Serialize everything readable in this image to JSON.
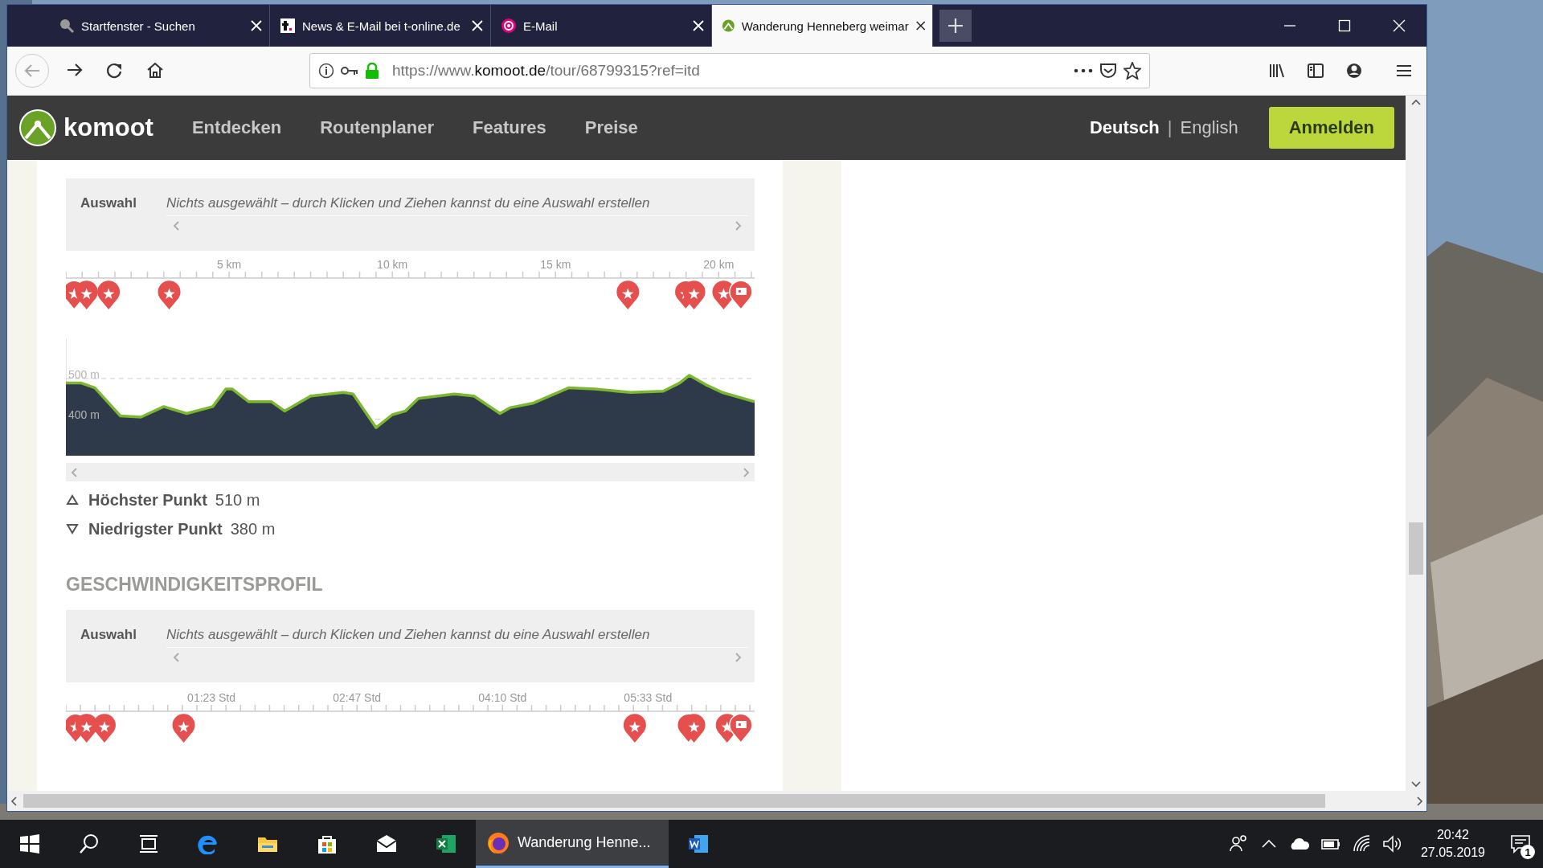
{
  "browser": {
    "tabs": [
      {
        "title": "Startfenster - Suchen",
        "selected": false
      },
      {
        "title": "News & E-Mail bei t-online.de",
        "selected": false
      },
      {
        "title": "E-Mail",
        "selected": false
      },
      {
        "title": "Wanderung Henneberg weimar",
        "selected": true
      }
    ],
    "url": {
      "prefix": "https://www.",
      "domain": "komoot.de",
      "path": "/tour/68799315?ref=itd"
    }
  },
  "site_header": {
    "logo": "komoot",
    "nav": [
      "Entdecken",
      "Routenplaner",
      "Features",
      "Preise"
    ],
    "languages": [
      {
        "label": "Deutsch",
        "selected": true
      },
      {
        "label": "English",
        "selected": false
      }
    ],
    "separator": "|",
    "login": "Anmelden"
  },
  "elevation_profile": {
    "selection": {
      "label": "Auswahl",
      "hint": "Nichts ausgewählt – durch Klicken und Ziehen kannst du eine Auswahl erstellen"
    },
    "chart_data": {
      "type": "area",
      "x": [
        0,
        0.47,
        0.89,
        1.67,
        2.3,
        3.0,
        3.7,
        4.5,
        4.9,
        5.1,
        5.6,
        6.3,
        6.7,
        7.5,
        8.5,
        8.8,
        9.5,
        10.0,
        10.4,
        10.8,
        11.9,
        12.5,
        13.3,
        13.6,
        14.3,
        15.4,
        16.2,
        17.3,
        18.3,
        18.8,
        19.1,
        19.6,
        20.1,
        21.1
      ],
      "series": [
        {
          "color": "#7cb82f",
          "values": [
            489,
            489,
            477,
            408,
            405,
            431,
            414,
            431,
            474,
            474,
            443,
            443,
            420,
            457,
            466,
            462,
            379,
            411,
            420,
            451,
            462,
            457,
            414,
            428,
            439,
            477,
            474,
            466,
            469,
            489,
            508,
            485,
            466,
            443
          ]
        }
      ],
      "xlim": [
        0,
        21.1
      ],
      "ylim": [
        310,
        599
      ],
      "xticks": [
        {
          "value": 5,
          "label": "5 km"
        },
        {
          "value": 10,
          "label": "10 km"
        },
        {
          "value": 15,
          "label": "15 km"
        },
        {
          "value": 20,
          "label": "20 km"
        }
      ],
      "yticks": [
        {
          "value": 400,
          "label": "400 m"
        },
        {
          "value": 500,
          "label": "500 m"
        }
      ]
    },
    "stats": [
      {
        "kind": "highest",
        "label": "Höchster Punkt",
        "value": "510 m"
      },
      {
        "kind": "lowest",
        "label": "Niedrigster Punkt",
        "value": "380 m"
      }
    ]
  },
  "speed_profile": {
    "title": "GESCHWINDIGKEITSPROFIL",
    "selection": {
      "label": "Auswahl",
      "hint": "Nichts ausgewählt – durch Klicken und Ziehen kannst du eine Auswahl erstellen"
    },
    "time_labels": [
      "01:23 Std",
      "02:47 Std",
      "04:10 Std",
      "05:33 Std"
    ]
  },
  "taskbar": {
    "window_button": {
      "label": "Wanderung Henne...",
      "selected": true
    },
    "clock": {
      "time": "20:42",
      "date": "27.05.2019"
    },
    "notification_count": "1"
  }
}
